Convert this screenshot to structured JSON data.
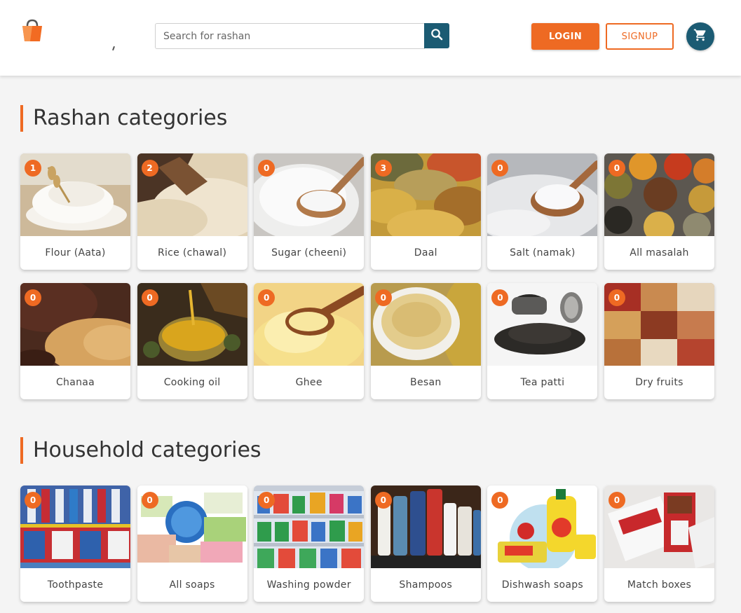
{
  "header": {
    "search": {
      "placeholder": "Search for rashan",
      "value": ""
    },
    "login_label": "LOGIN",
    "signup_label": "SIGNUP",
    "icons": {
      "logo": "shopping-bag-icon",
      "search": "search-icon",
      "cart": "cart-icon"
    }
  },
  "colors": {
    "accent": "#ee6a23",
    "primary": "#1b5b73",
    "background": "#f4f4f4"
  },
  "rashan": {
    "title": "Rashan categories",
    "items": [
      {
        "label": "Flour (Aata)",
        "count": "1"
      },
      {
        "label": "Rice (chawal)",
        "count": "2"
      },
      {
        "label": "Sugar (cheeni)",
        "count": "0"
      },
      {
        "label": "Daal",
        "count": "3"
      },
      {
        "label": "Salt (namak)",
        "count": "0"
      },
      {
        "label": "All masalah",
        "count": "0"
      },
      {
        "label": "Chanaa",
        "count": "0"
      },
      {
        "label": "Cooking oil",
        "count": "0"
      },
      {
        "label": "Ghee",
        "count": "0"
      },
      {
        "label": "Besan",
        "count": "0"
      },
      {
        "label": "Tea patti",
        "count": "0"
      },
      {
        "label": "Dry fruits",
        "count": "0"
      }
    ]
  },
  "household": {
    "title": "Household categories",
    "items": [
      {
        "label": "Toothpaste",
        "count": "0"
      },
      {
        "label": "All soaps",
        "count": "0"
      },
      {
        "label": "Washing powder",
        "count": "0"
      },
      {
        "label": "Shampoos",
        "count": "0"
      },
      {
        "label": "Dishwash soaps",
        "count": "0"
      },
      {
        "label": "Match boxes",
        "count": "0"
      }
    ]
  }
}
